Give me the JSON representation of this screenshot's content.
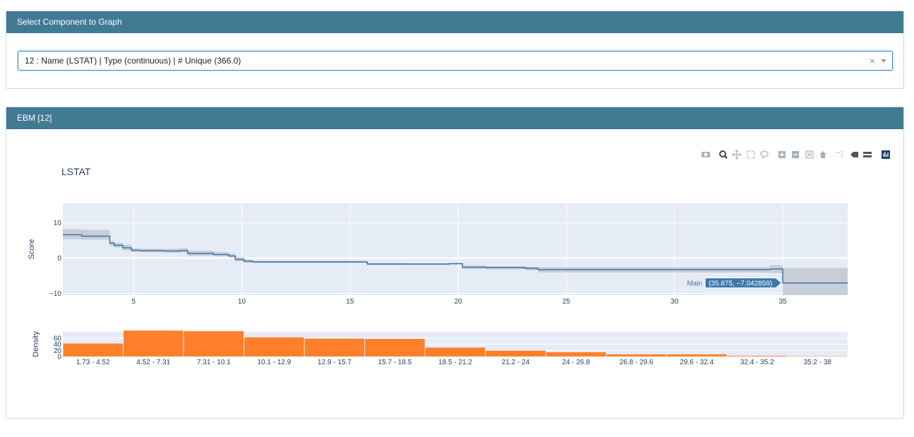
{
  "component_panel": {
    "header": "Select Component to Graph",
    "selected_value": "12 : Name (LSTAT) | Type (continuous) | # Unique (366.0)",
    "clear_glyph": "×"
  },
  "ebm_panel": {
    "header": "EBM [12]",
    "plot_title": "LSTAT",
    "toolbar_icons": [
      "camera-icon",
      "zoom-icon",
      "pan-icon",
      "box-select-icon",
      "lasso-select-icon",
      "zoom-in-icon",
      "zoom-out-icon",
      "autoscale-icon",
      "reset-axes-icon",
      "spike-lines-icon",
      "hover-closest-icon",
      "hover-compare-icon",
      "plotly-logo-icon"
    ],
    "hover_label": {
      "series": "Main",
      "value": "(35.875, −7.042859)"
    }
  },
  "colors": {
    "header_bg": "#417a93",
    "line": "#3a76a8",
    "band": "#c2c9d3",
    "plot_bg": "#e5ecf6",
    "bar": "#ff7f2a"
  },
  "chart_data": [
    {
      "type": "line",
      "title": "LSTAT",
      "xlabel": "",
      "ylabel": "Score",
      "xlim": [
        1.73,
        38
      ],
      "ylim": [
        -10.5,
        15.5
      ],
      "xticks": [
        5,
        10,
        15,
        20,
        25,
        30,
        35
      ],
      "yticks": [
        10,
        0,
        -10
      ],
      "ytick_labels": [
        "10",
        "0",
        "−10"
      ],
      "grid": true,
      "series": [
        {
          "name": "Main",
          "step": true,
          "x": [
            1.73,
            2.6,
            3.9,
            4.1,
            4.5,
            4.9,
            5.3,
            6.4,
            7.1,
            7.5,
            8.7,
            9.4,
            9.7,
            10.1,
            10.5,
            13.6,
            15.8,
            17.5,
            19.6,
            20.2,
            21.3,
            23.1,
            23.7,
            26.7,
            34.4,
            35.0,
            38.0
          ],
          "y": [
            6.6,
            6.2,
            4.2,
            3.6,
            2.9,
            2.2,
            2.1,
            2.0,
            2.1,
            1.3,
            1.0,
            0.6,
            -0.4,
            -0.9,
            -1.1,
            -1.1,
            -1.7,
            -1.7,
            -1.6,
            -2.6,
            -2.7,
            -2.9,
            -3.3,
            -3.3,
            -3.1,
            -7.04,
            -7.04
          ],
          "upper": [
            8.2,
            8.0,
            4.8,
            4.3,
            3.8,
            2.8,
            2.6,
            2.6,
            2.8,
            2.1,
            1.7,
            1.2,
            0.2,
            -0.4,
            -0.8,
            -0.8,
            -1.4,
            -1.5,
            -1.4,
            -2.1,
            -2.3,
            -2.5,
            -2.6,
            -2.6,
            -2.0,
            -2.8,
            -2.8
          ],
          "lower": [
            5.3,
            5.2,
            3.6,
            3.0,
            2.2,
            1.7,
            1.6,
            1.5,
            1.5,
            0.6,
            0.5,
            0.1,
            -0.9,
            -1.3,
            -1.4,
            -1.4,
            -2.0,
            -2.0,
            -1.8,
            -3.1,
            -3.2,
            -3.5,
            -4.1,
            -4.1,
            -4.3,
            -10.5,
            -10.5
          ]
        }
      ]
    },
    {
      "type": "bar",
      "xlabel": "",
      "ylabel": "Density",
      "ylim": [
        0,
        80
      ],
      "yticks": [
        0,
        20,
        40,
        60
      ],
      "categories": [
        "1.73 - 4.52",
        "4.52 - 7.31",
        "7.31 - 10.1",
        "10.1 - 12.9",
        "12.9 - 15.7",
        "15.7 - 18.5",
        "18.5 - 21.2",
        "21.2 - 24",
        "24 - 26.8",
        "26.8 - 29.6",
        "29.6 - 32.4",
        "32.4 - 35.2",
        "35.2 - 38"
      ],
      "values": [
        42,
        84,
        82,
        62,
        58,
        57,
        29,
        19,
        14,
        7,
        7,
        2,
        1
      ]
    }
  ]
}
